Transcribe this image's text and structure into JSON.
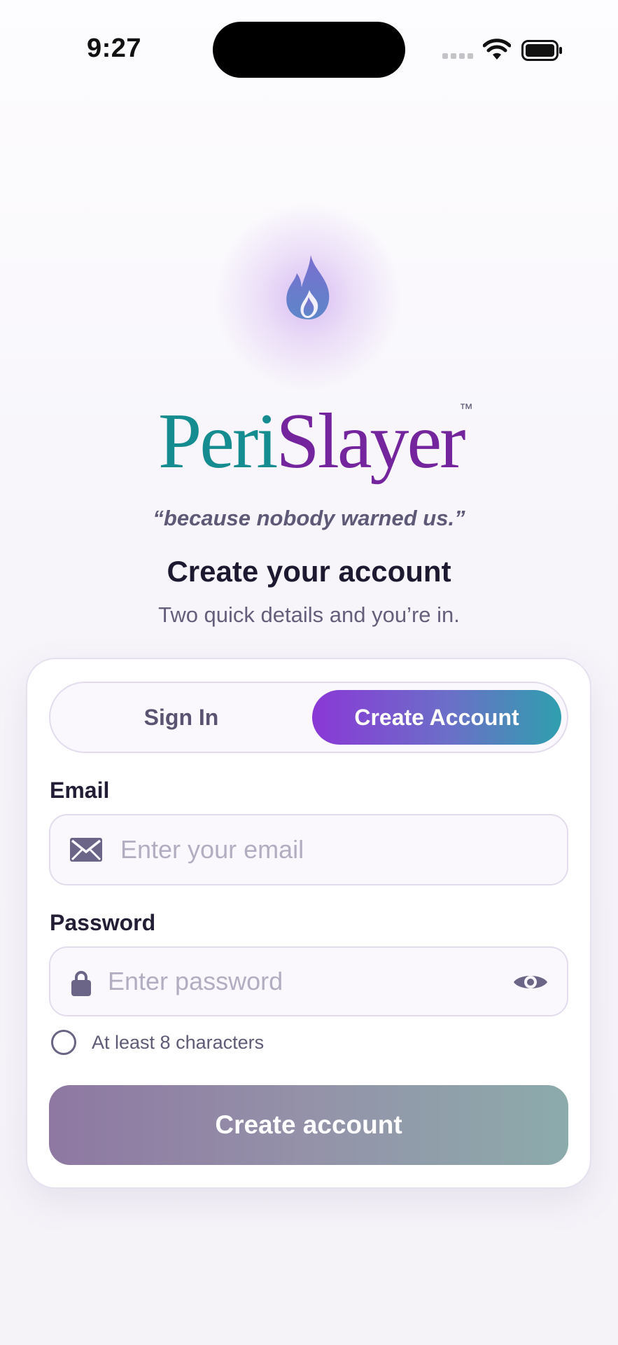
{
  "status_bar": {
    "time": "9:27"
  },
  "brand": {
    "name_part1": "Peri",
    "name_part2": "Slayer",
    "trademark": "™",
    "tagline": "“because nobody warned us.”"
  },
  "header": {
    "title": "Create your account",
    "subtitle": "Two quick details and you’re in."
  },
  "auth_toggle": {
    "sign_in_label": "Sign In",
    "create_account_label": "Create Account",
    "selected": "Create Account"
  },
  "email": {
    "label": "Email",
    "placeholder": "Enter your email",
    "value": ""
  },
  "password": {
    "label": "Password",
    "placeholder": "Enter password",
    "value": ""
  },
  "password_hint": "At least 8 characters",
  "submit_label": "Create account",
  "icons": [
    "flame-icon",
    "mail-icon",
    "lock-icon",
    "eye-icon",
    "wifi-icon",
    "battery-icon",
    "cellular-signal-icon"
  ],
  "colors": {
    "accent_purple": "#8a38d6",
    "accent_teal": "#2f9fae",
    "brand_teal": "#158c8f",
    "brand_purple": "#74259e"
  }
}
